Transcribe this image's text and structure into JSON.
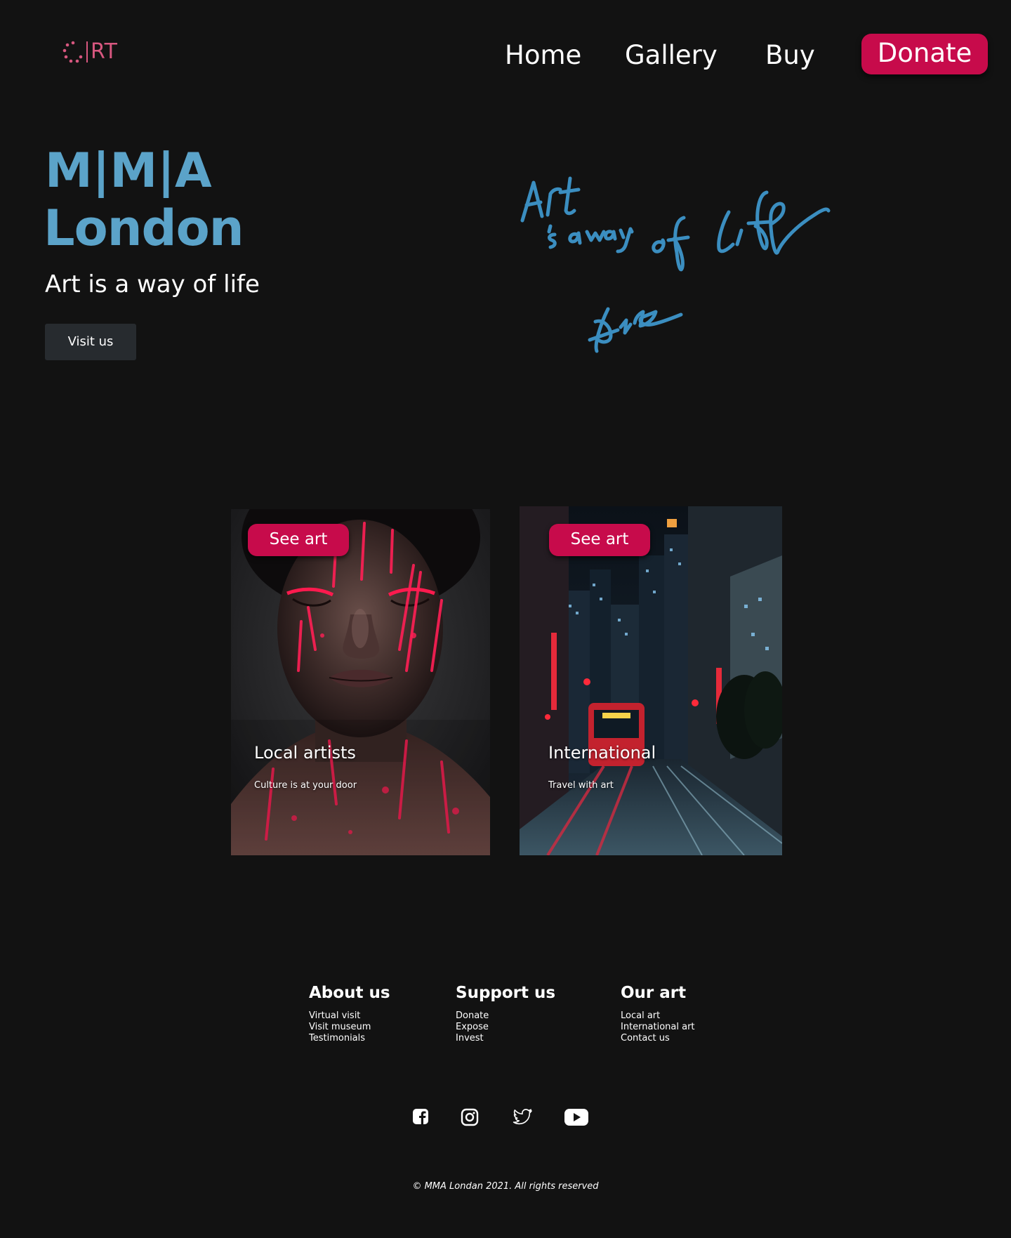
{
  "header": {
    "logo_text": "RT",
    "nav": {
      "home": "Home",
      "gallery": "Gallery",
      "buy": "Buy"
    },
    "donate_label": "Donate"
  },
  "hero": {
    "brand": "M|M|A",
    "city": "London",
    "tagline": "Art is a way of life",
    "visit_label": "Visit us",
    "accent_color": "#5ba3c9"
  },
  "cards": [
    {
      "button_label": "See art",
      "title": "Local artists",
      "subtitle": "Culture is at your door",
      "image": "face-paint-portrait"
    },
    {
      "button_label": "See art",
      "title": "International",
      "subtitle": "Travel with art",
      "image": "night-city-street-tram"
    }
  ],
  "footer": {
    "columns": [
      {
        "heading": "About us",
        "links": [
          "Virtual visit",
          "Visit museum",
          "Testimonials"
        ]
      },
      {
        "heading": "Support us",
        "links": [
          "Donate",
          "Expose",
          "Invest"
        ]
      },
      {
        "heading": "Our art",
        "links": [
          "Local art",
          "International art",
          "Contact us"
        ]
      }
    ],
    "social": [
      "facebook-icon",
      "instagram-icon",
      "twitter-icon",
      "youtube-icon"
    ],
    "copyright": "© MMA Londan 2021. All rights reserved"
  },
  "colors": {
    "background": "#121212",
    "brand_red": "#c70b4b",
    "logo_pink": "#d7577f",
    "button_dark": "#272b2f"
  }
}
